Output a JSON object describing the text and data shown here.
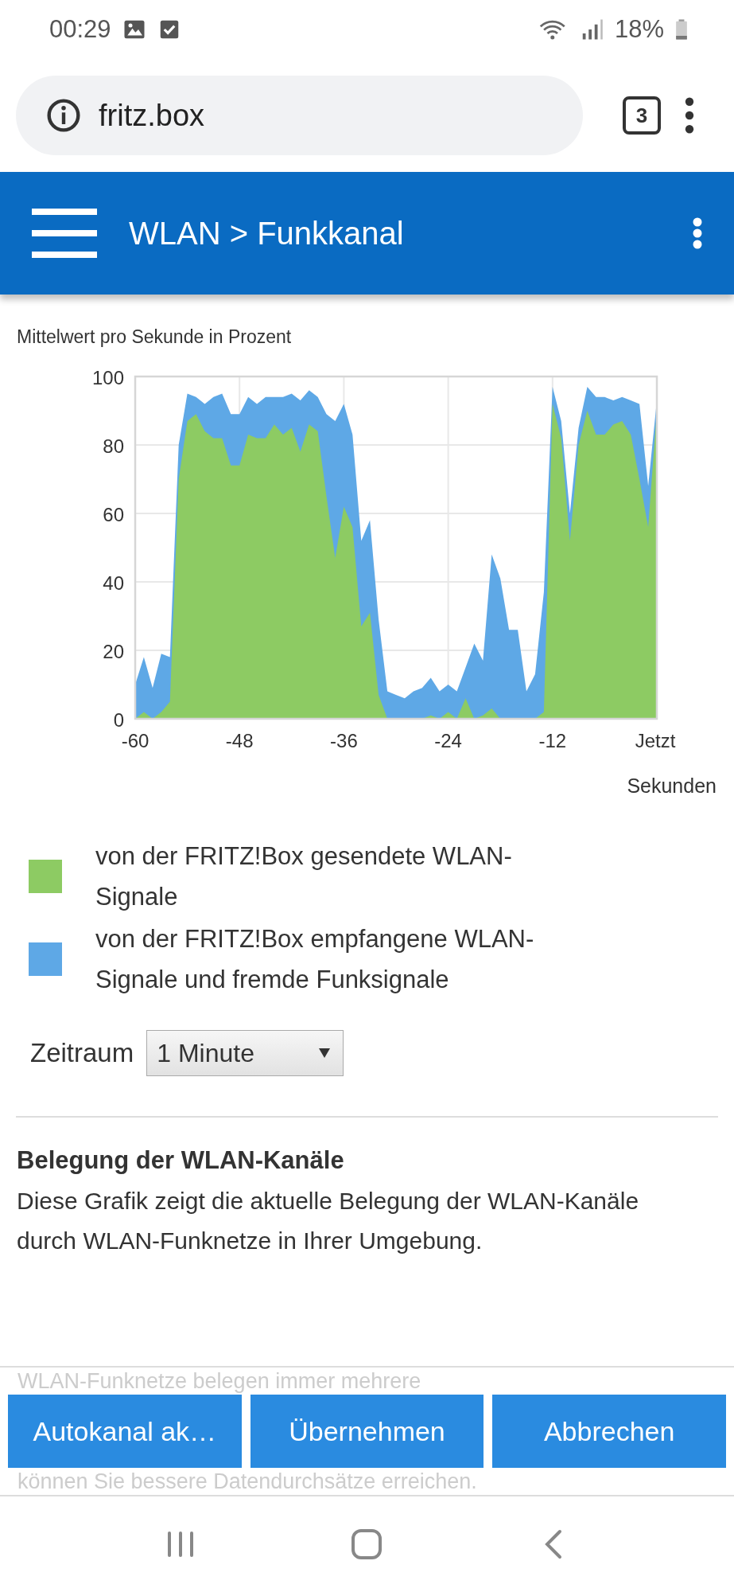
{
  "status_bar": {
    "time": "00:29",
    "battery": "18%"
  },
  "browser": {
    "url": "fritz.box",
    "tab_count": "3"
  },
  "header": {
    "title": "WLAN > Funkkanal"
  },
  "chart": {
    "chart_data": {
      "type": "area",
      "ylabel": "Mittelwert pro Sekunde in Prozent",
      "xlabel": "Sekunden",
      "x": [
        -60,
        -59,
        -58,
        -57,
        -56,
        -55,
        -54,
        -53,
        -52,
        -51,
        -50,
        -49,
        -48,
        -47,
        -46,
        -45,
        -44,
        -43,
        -42,
        -41,
        -40,
        -39,
        -38,
        -37,
        -36,
        -35,
        -34,
        -33,
        -32,
        -31,
        -30,
        -29,
        -28,
        -27,
        -26,
        -25,
        -24,
        -23,
        -22,
        -21,
        -20,
        -19,
        -18,
        -17,
        -16,
        -15,
        -14,
        -13,
        -12,
        -11,
        -10,
        -9,
        -8,
        -7,
        -6,
        -5,
        -4,
        -3,
        -2,
        -1,
        0
      ],
      "series": [
        {
          "name": "von der FRITZ!Box gesendete WLAN-Signale",
          "color": "#8dcb63",
          "values": [
            0,
            2,
            0,
            2,
            5,
            70,
            87,
            89,
            84,
            82,
            82,
            74,
            74,
            83,
            82,
            82,
            86,
            83,
            85,
            78,
            86,
            84,
            65,
            47,
            62,
            56,
            27,
            31,
            7,
            0,
            0,
            0,
            0,
            0,
            1,
            0,
            2,
            0,
            6,
            0,
            1,
            3,
            0,
            0,
            0,
            0,
            0,
            2,
            92,
            82,
            52,
            80,
            90,
            83,
            83,
            86,
            87,
            83,
            70,
            56,
            90
          ]
        },
        {
          "name": "von der FRITZ!Box empfangene WLAN-Signale und fremde Funksignale",
          "color": "#5ea8e6",
          "values": [
            10,
            18,
            9,
            19,
            18,
            80,
            95,
            94,
            92,
            94,
            95,
            89,
            89,
            94,
            92,
            94,
            94,
            94,
            95,
            93,
            96,
            94,
            89,
            87,
            92,
            83,
            52,
            58,
            29,
            8,
            7,
            6,
            8,
            9,
            12,
            8,
            10,
            8,
            15,
            22,
            17,
            48,
            41,
            26,
            26,
            8,
            13,
            37,
            97,
            87,
            60,
            85,
            97,
            94,
            94,
            93,
            94,
            93,
            92,
            68,
            93
          ]
        }
      ],
      "grid": true,
      "xlim": [
        -60,
        0
      ],
      "ylim": [
        0,
        100
      ],
      "xticks": [
        -60,
        -48,
        -36,
        -24,
        -12,
        {
          "value": 0,
          "label": "Jetzt"
        }
      ],
      "yticks": [
        0,
        20,
        40,
        60,
        80,
        100
      ]
    }
  },
  "period": {
    "label": "Zeitraum",
    "value": "1 Minute"
  },
  "section": {
    "heading": "Belegung der WLAN-Kanäle",
    "text": "Diese Grafik zeigt die aktuelle Belegung der WLAN-Kanäle durch WLAN-Funknetze in Ihrer Umgebung.",
    "faded_lines": [
      "WLAN-Funknetze belegen immer mehrere",
      "können Sie bessere Datendurchsätze erreichen."
    ]
  },
  "buttons": [
    "Autokanal ak…",
    "Übernehmen",
    "Abbrechen"
  ]
}
